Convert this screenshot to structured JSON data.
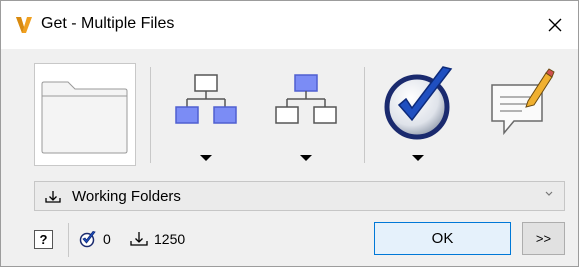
{
  "window": {
    "title": "Get - Multiple Files",
    "close_icon": "close-icon",
    "app_icon": "vault-logo-icon",
    "accent": "#f0a020"
  },
  "toolbar": {
    "buttons": [
      {
        "name": "folder-button",
        "icon": "folder-icon"
      },
      {
        "name": "structure-children-button",
        "icon": "hierarchy-children-icon",
        "has_dropdown": true
      },
      {
        "name": "structure-parent-button",
        "icon": "hierarchy-parent-icon",
        "has_dropdown": true
      },
      {
        "name": "check-button",
        "icon": "blue-checkmark-icon",
        "has_dropdown": true
      },
      {
        "name": "comment-button",
        "icon": "comment-pencil-icon"
      }
    ]
  },
  "location": {
    "selected": "Working Folders",
    "icon": "download-arrow-icon"
  },
  "status": {
    "help_label": "?",
    "checked_count": "0",
    "file_count": "1250",
    "ok_label": "OK",
    "more_label": ">>"
  }
}
